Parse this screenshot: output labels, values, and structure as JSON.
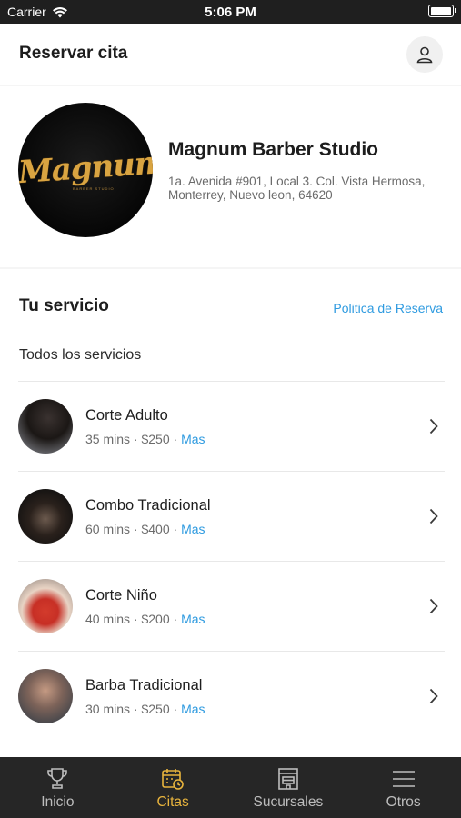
{
  "status_bar": {
    "carrier": "Carrier",
    "time": "5:06 PM"
  },
  "header": {
    "title": "Reservar cita"
  },
  "shop": {
    "logo_text": "Magnum",
    "logo_subtext": "BARBER STUDIO",
    "name": "Magnum Barber Studio",
    "address": "1a. Avenida #901, Local 3. Col. Vista Hermosa, Monterrey, Nuevo leon, 64620"
  },
  "services_section": {
    "title": "Tu servicio",
    "policy_link": "Politica de Reserva",
    "subtitle": "Todos los servicios",
    "items": [
      {
        "name": "Corte Adulto",
        "duration": "35 mins",
        "price": "$250",
        "more": "Mas"
      },
      {
        "name": "Combo Tradicional",
        "duration": "60 mins",
        "price": "$400",
        "more": "Mas"
      },
      {
        "name": "Corte Niño",
        "duration": "40 mins",
        "price": "$200",
        "more": "Mas"
      },
      {
        "name": "Barba Tradicional",
        "duration": "30 mins",
        "price": "$250",
        "more": "Mas"
      }
    ]
  },
  "tabbar": {
    "tabs": [
      {
        "label": "Inicio",
        "icon": "trophy-icon"
      },
      {
        "label": "Citas",
        "icon": "calendar-icon",
        "active": true
      },
      {
        "label": "Sucursales",
        "icon": "store-icon"
      },
      {
        "label": "Otros",
        "icon": "menu-icon"
      }
    ]
  },
  "colors": {
    "accent": "#e8b43d",
    "link": "#2f9be0",
    "tabbar_bg": "#262626"
  }
}
